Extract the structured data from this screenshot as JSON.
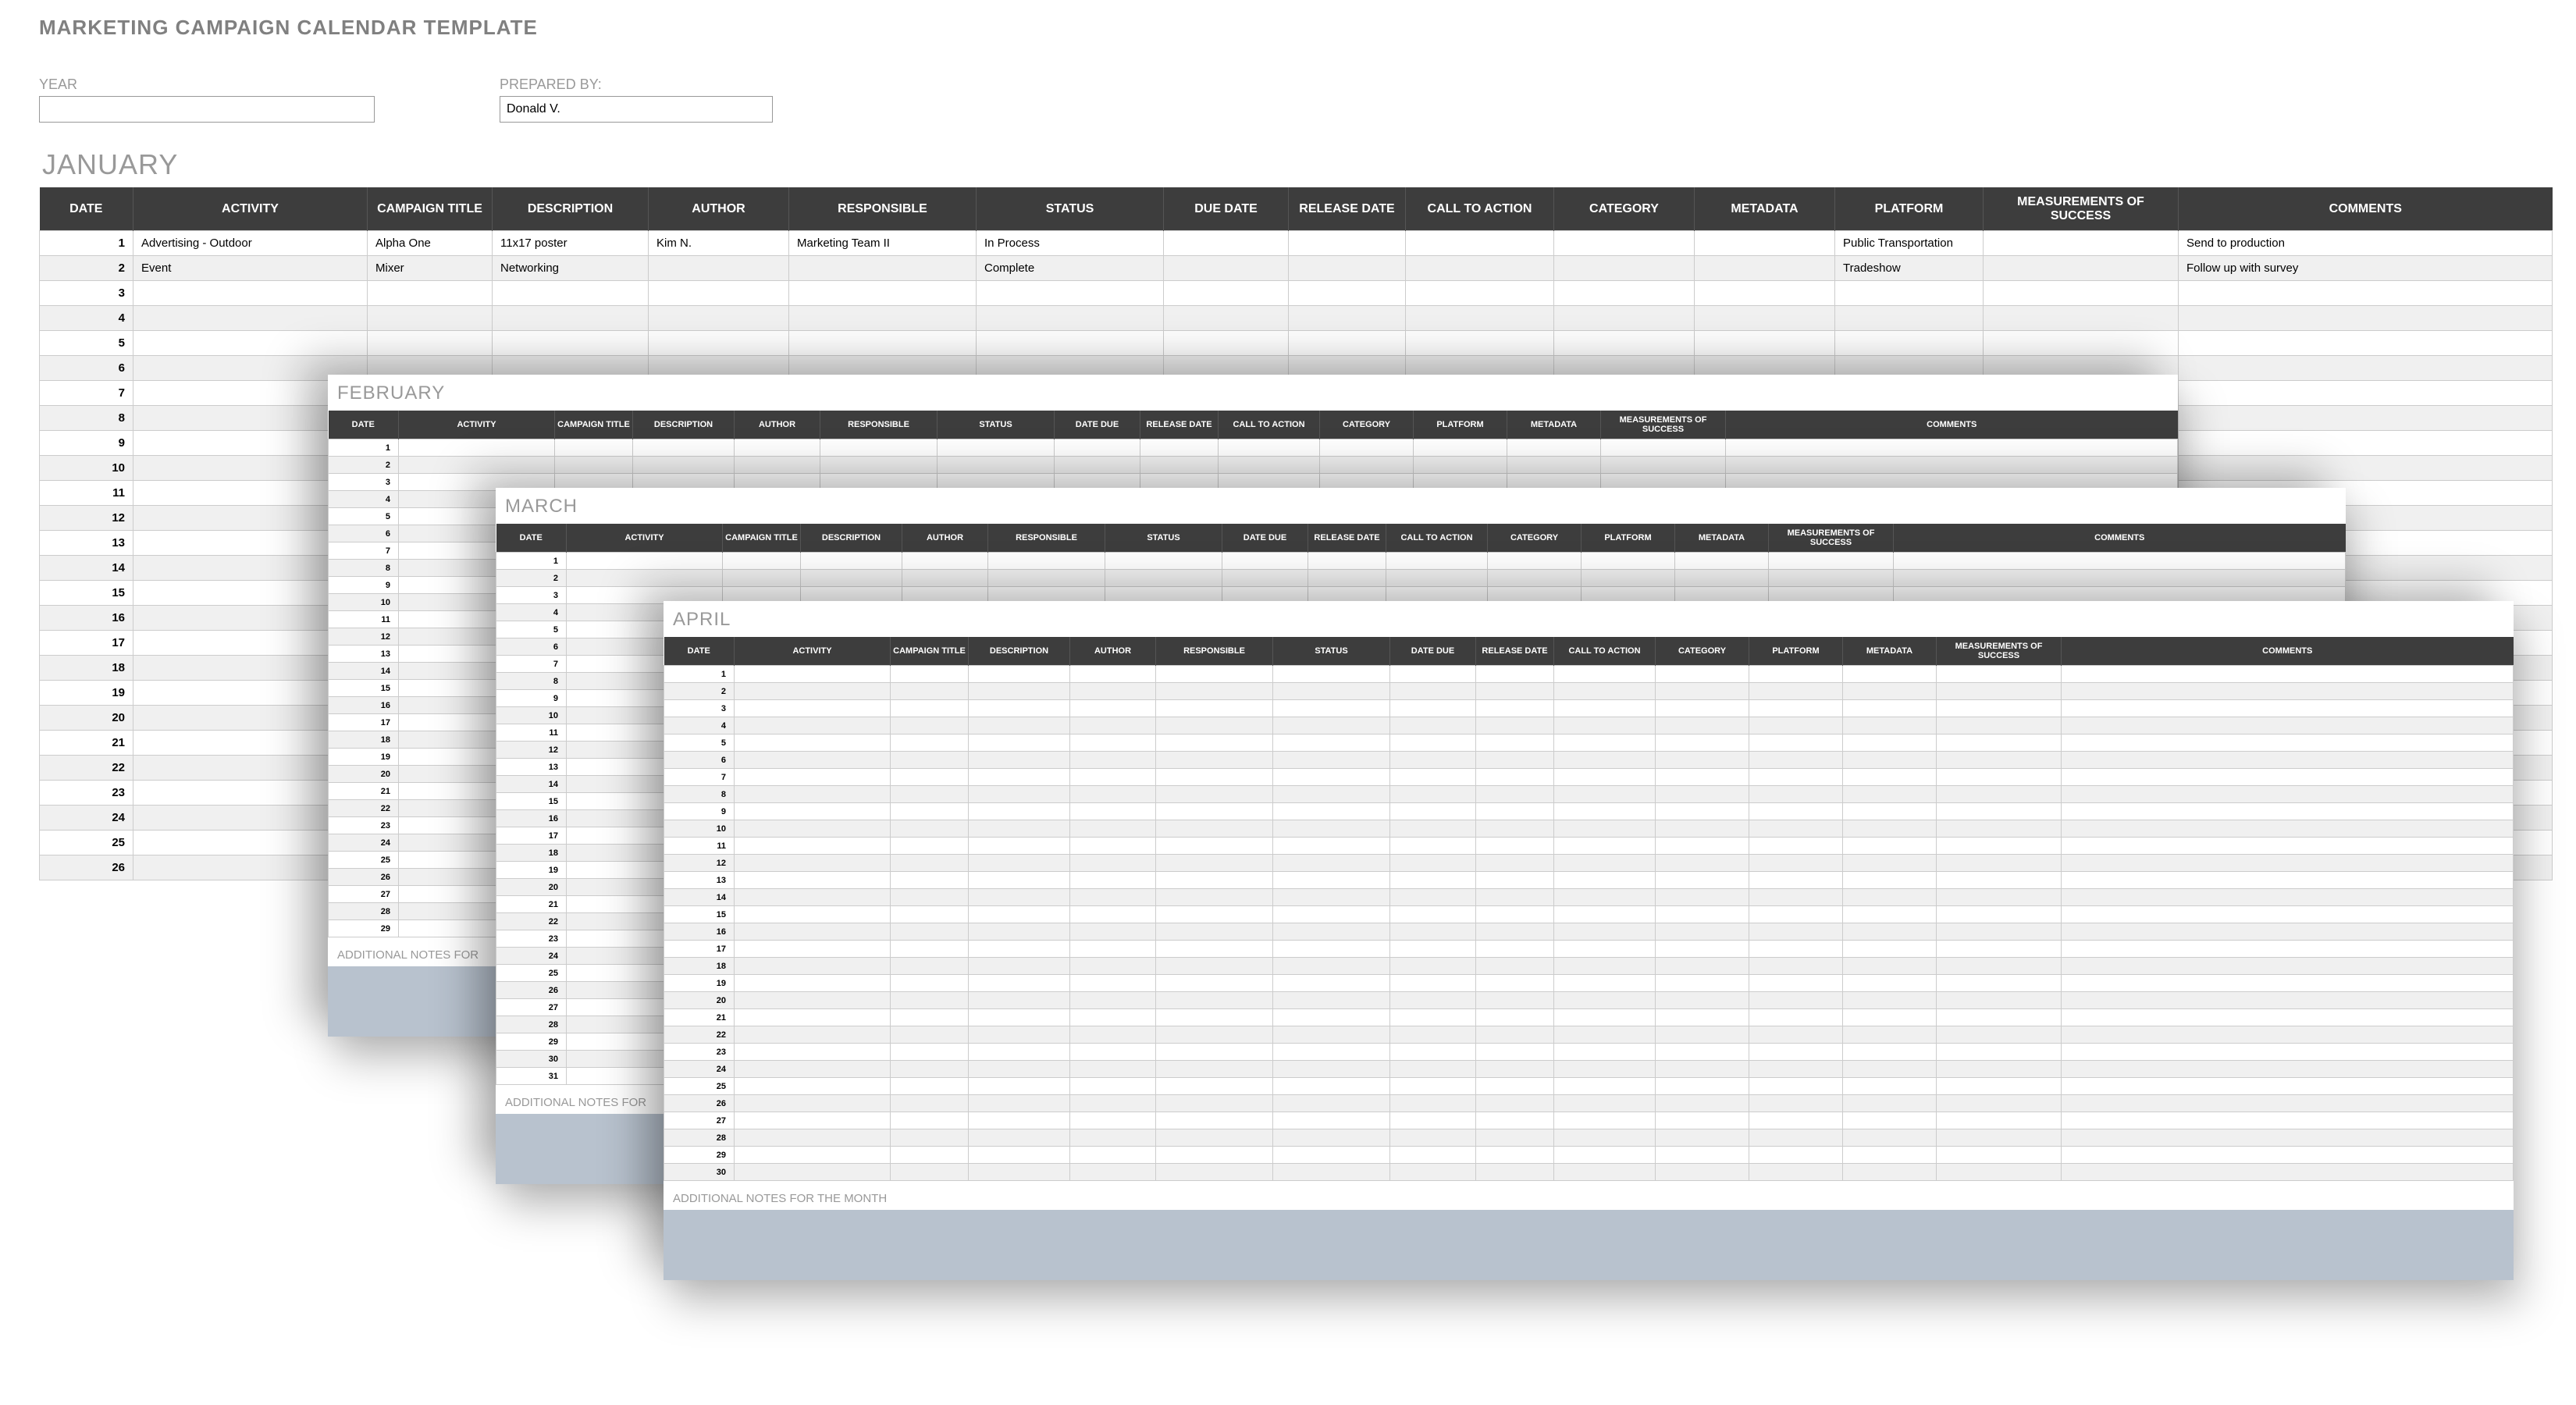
{
  "title": "MARKETING CAMPAIGN CALENDAR TEMPLATE",
  "fields": {
    "year_label": "YEAR",
    "year_value": "",
    "prepared_by_label": "PREPARED BY:",
    "prepared_by_value": "Donald V."
  },
  "columns_jan": [
    "DATE",
    "ACTIVITY",
    "CAMPAIGN TITLE",
    "DESCRIPTION",
    "AUTHOR",
    "RESPONSIBLE",
    "STATUS",
    "DUE DATE",
    "RELEASE DATE",
    "CALL TO ACTION",
    "CATEGORY",
    "METADATA",
    "PLATFORM",
    "MEASUREMENTS OF SUCCESS",
    "COMMENTS"
  ],
  "columns_other": [
    "DATE",
    "ACTIVITY",
    "CAMPAIGN TITLE",
    "DESCRIPTION",
    "AUTHOR",
    "RESPONSIBLE",
    "STATUS",
    "DATE DUE",
    "RELEASE DATE",
    "CALL TO ACTION",
    "CATEGORY",
    "PLATFORM",
    "METADATA",
    "MEASUREMENTS OF SUCCESS",
    "COMMENTS"
  ],
  "months": {
    "jan": {
      "title": "JANUARY",
      "rows": 26
    },
    "feb": {
      "title": "FEBRUARY",
      "rows": 29
    },
    "mar": {
      "title": "MARCH",
      "rows": 31
    },
    "apr": {
      "title": "APRIL",
      "rows": 30
    }
  },
  "jan_data": [
    {
      "date": "1",
      "activity": "Advertising - Outdoor",
      "campaign": "Alpha One",
      "description": "11x17 poster",
      "author": "Kim N.",
      "responsible": "Marketing Team II",
      "status": "In Process",
      "due": "",
      "release": "",
      "cta": "",
      "category": "",
      "metadata": "",
      "platform": "Public Transportation",
      "measure": "",
      "comments": "Send to production"
    },
    {
      "date": "2",
      "activity": "Event",
      "campaign": "Mixer",
      "description": "Networking",
      "author": "",
      "responsible": "",
      "status": "Complete",
      "due": "",
      "release": "",
      "cta": "",
      "category": "",
      "metadata": "",
      "platform": "Tradeshow",
      "measure": "",
      "comments": "Follow up with survey"
    }
  ],
  "notes_label_partial": "ADDITIONAL NOTES FOR",
  "notes_label_full": "ADDITIONAL NOTES FOR THE MONTH"
}
